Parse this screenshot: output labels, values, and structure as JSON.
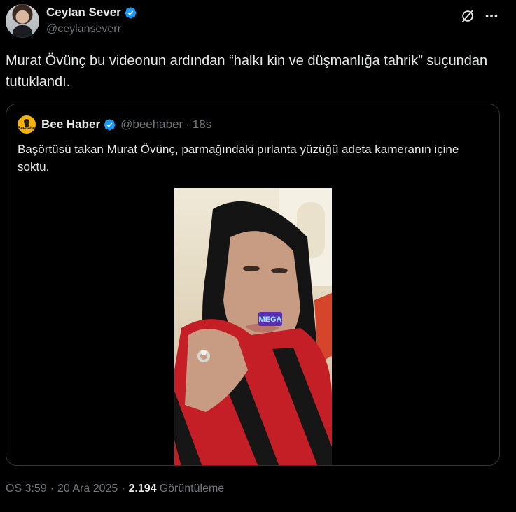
{
  "author": {
    "name": "Ceylan Sever",
    "handle": "@ceylanseverr",
    "verified_color": "#1d9bf0"
  },
  "header_icons": [
    "grok-icon",
    "more-icon"
  ],
  "tweet": {
    "text": "Murat Övünç bu videonun ardından “halkı kin ve düşmanlığa tahrik” suçundan tutuklandı."
  },
  "quote": {
    "avatar_text": "Beehaber",
    "name": "Bee Haber",
    "handle": "@beehaber",
    "separator": "·",
    "time": "18s",
    "text": "Başörtüsü takan Murat Övünç, parmağındaki pırlanta yüzüğü adeta kameranın içine soktu.",
    "media_sticker": "MEGA"
  },
  "footer": {
    "time": "ÖS 3:59",
    "date": "20 Ara 2025",
    "views_count": "2.194",
    "views_label": "Görüntüleme",
    "separator": "·"
  }
}
